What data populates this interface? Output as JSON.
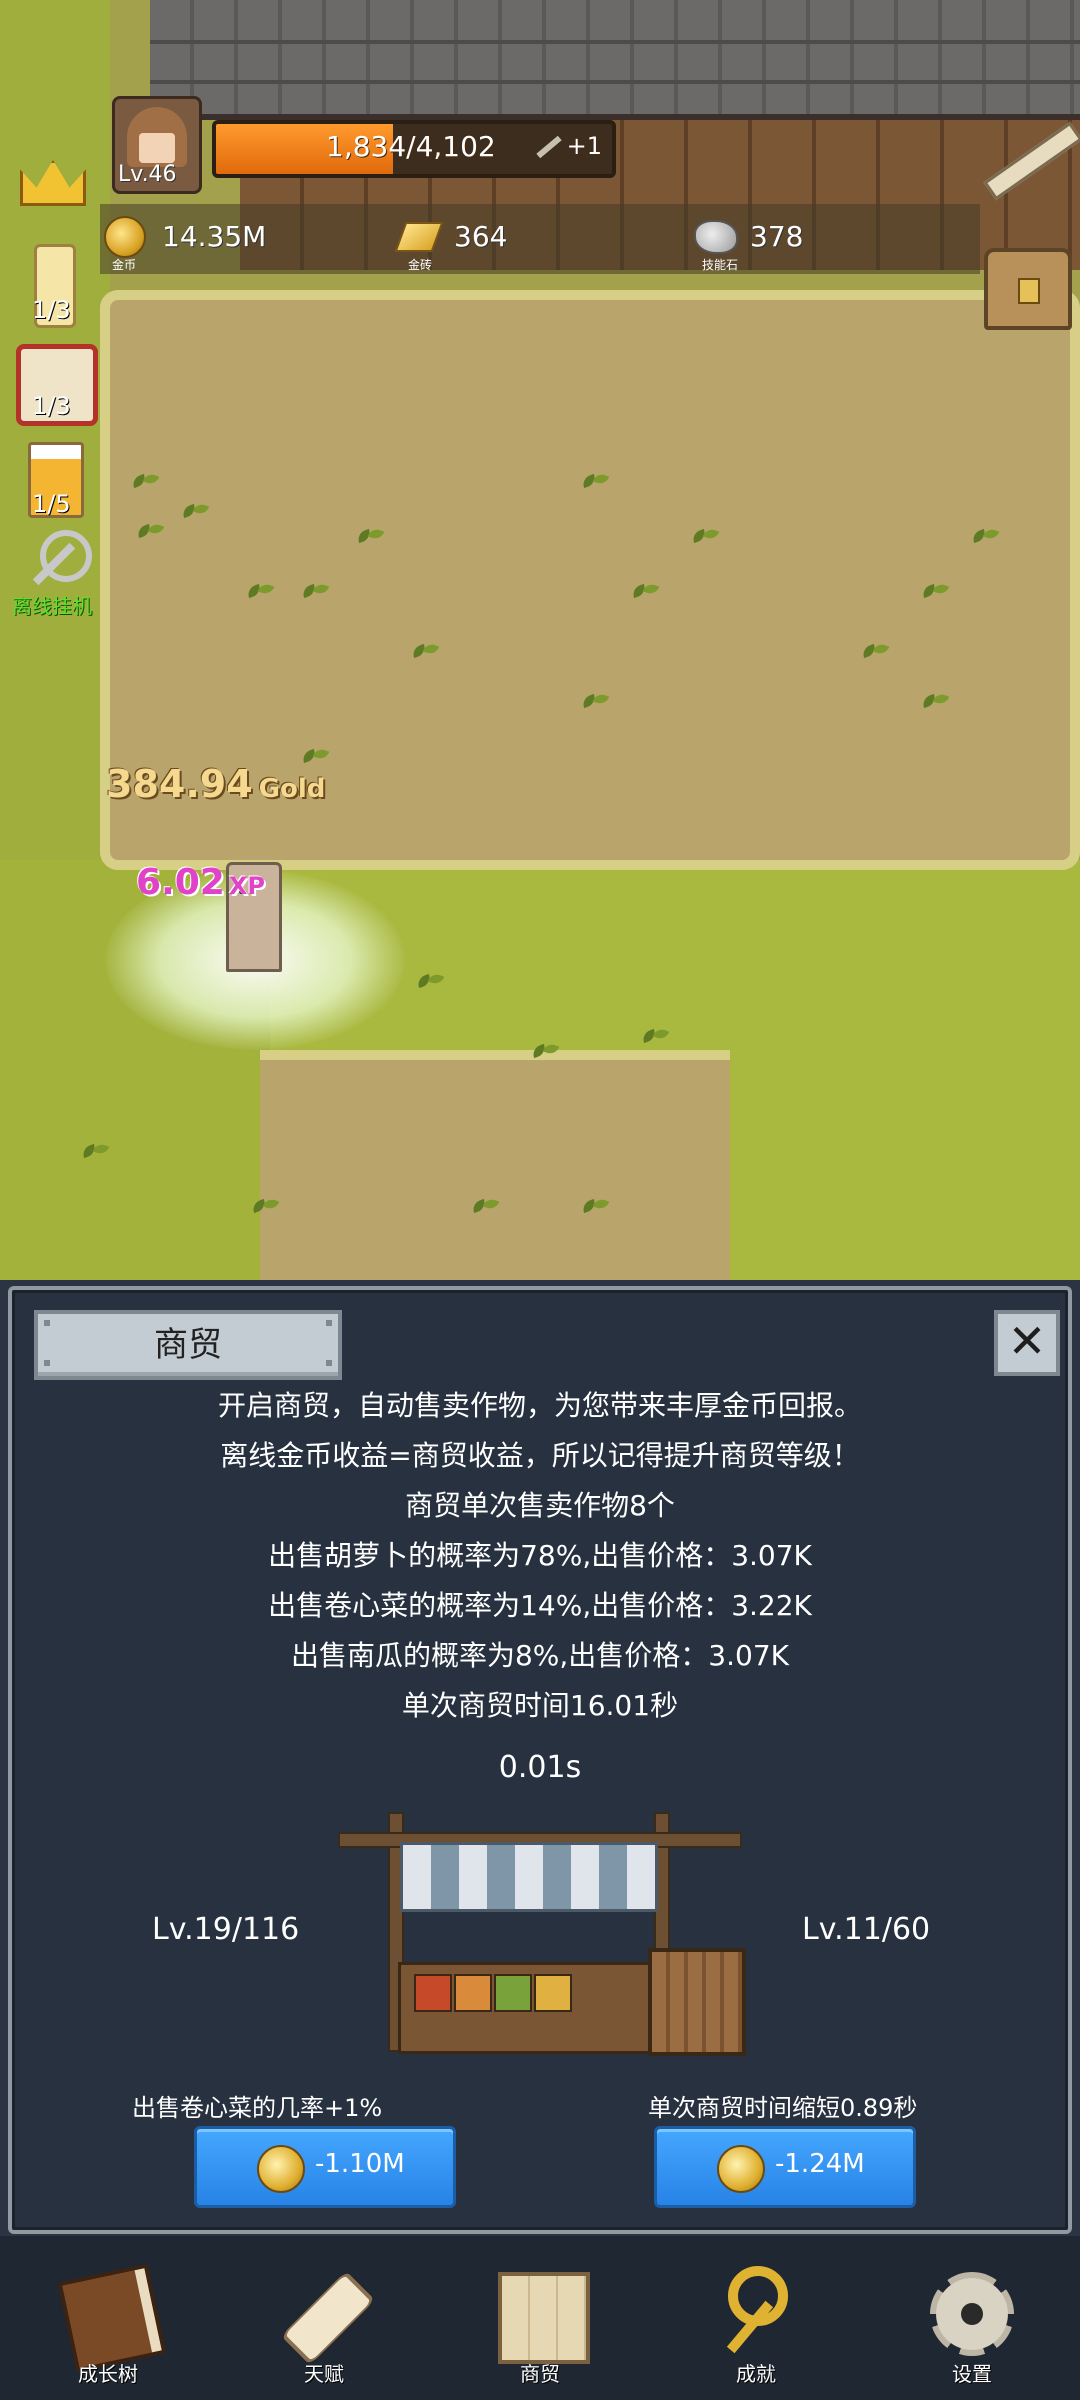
{
  "hud": {
    "level": "Lv.46",
    "xp_text": "1,834/4,102",
    "xp_fraction": 0.447,
    "xp_bonus": "+1",
    "resources": [
      {
        "icon": "gold-coin-icon",
        "value": "14.35M",
        "caption": "金币"
      },
      {
        "icon": "gold-brick-icon",
        "value": "364",
        "caption": "金砖"
      },
      {
        "icon": "skill-stone-icon",
        "value": "378",
        "caption": "技能石"
      }
    ],
    "side": {
      "candle_count": "1/3",
      "dice_count": "1/3",
      "beer_count": "1/5",
      "offline_label": "离线挂机"
    }
  },
  "field": {
    "gold_popup": {
      "value": "384.94",
      "unit": "Gold"
    },
    "xp_popup": {
      "value": "6.02",
      "unit": "XP"
    }
  },
  "panel": {
    "title": "商贸",
    "close": "✕",
    "lines": [
      "开启商贸，自动售卖作物，为您带来丰厚金币回报。",
      "离线金币收益=商贸收益，所以记得提升商贸等级！",
      "商贸单次售卖作物8个",
      "出售胡萝卜的概率为78%,出售价格：3.07K",
      "出售卷心菜的概率为14%,出售价格：3.22K",
      "出售南瓜的概率为8%,出售价格：3.07K",
      "单次商贸时间16.01秒"
    ],
    "timer": "0.01s",
    "left_upgrade": {
      "level": "Lv.19/116",
      "desc": "出售卷心菜的几率+1%",
      "cost": "-1.10M"
    },
    "right_upgrade": {
      "level": "Lv.11/60",
      "desc": "单次商贸时间缩短0.89秒",
      "cost": "-1.24M"
    }
  },
  "nav": {
    "items": [
      {
        "label": "成长树",
        "icon": "book-icon"
      },
      {
        "label": "天赋",
        "icon": "scroll-icon"
      },
      {
        "label": "商贸",
        "icon": "map-icon"
      },
      {
        "label": "成就",
        "icon": "key-icon"
      },
      {
        "label": "设置",
        "icon": "gear-icon"
      }
    ]
  }
}
